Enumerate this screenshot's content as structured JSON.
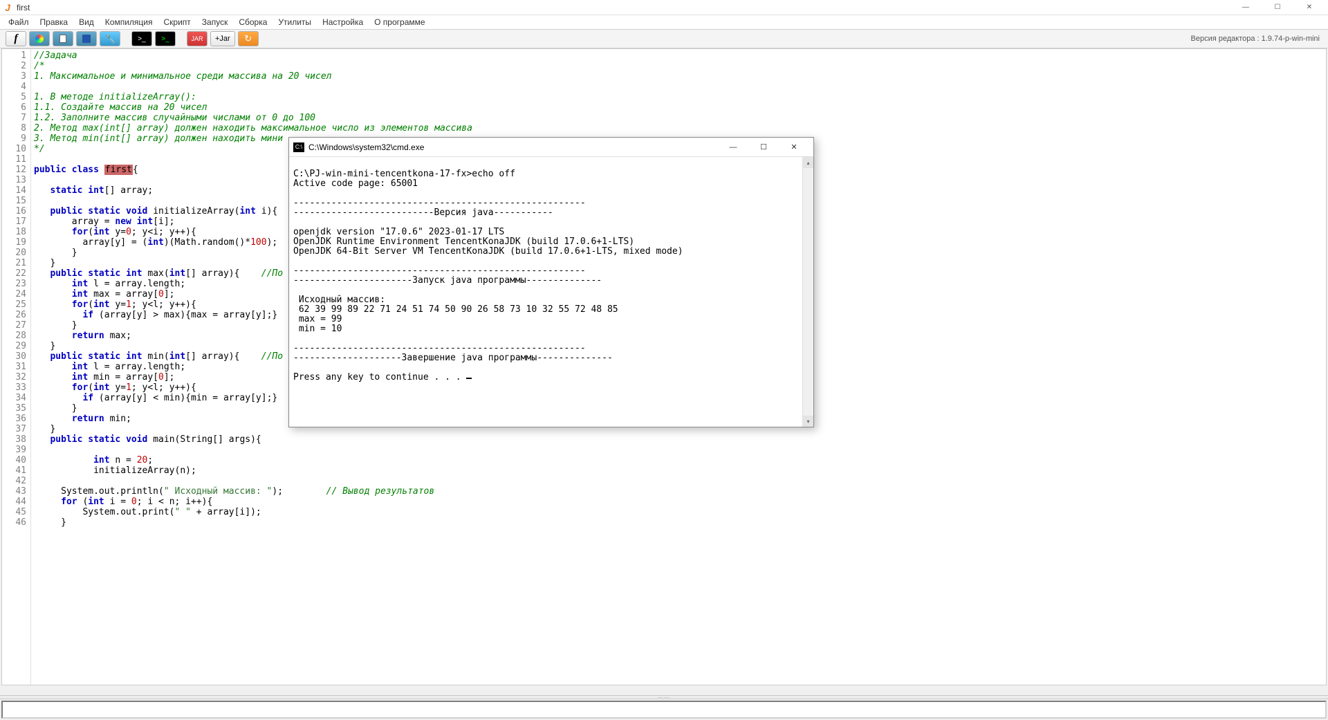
{
  "window": {
    "title": "first"
  },
  "menus": [
    "Файл",
    "Правка",
    "Вид",
    "Компиляция",
    "Скрипт",
    "Запуск",
    "Сборка",
    "Утилиты",
    "Настройка",
    "О программе"
  ],
  "toolbar": {
    "jar_label": "+Jar"
  },
  "version": "Версия редактора : 1.9.74-p-win-mini",
  "code": {
    "lines": [
      {
        "n": 1,
        "html": "<span class='c-comment'>//Задача</span>"
      },
      {
        "n": 2,
        "html": "<span class='c-comment'>/*</span>"
      },
      {
        "n": 3,
        "html": "<span class='c-comment'>1. Максимальное и минимальное среди массива на 20 чисел</span>"
      },
      {
        "n": 4,
        "html": ""
      },
      {
        "n": 5,
        "html": "<span class='c-comment'>1. В методе initializeArray():</span>"
      },
      {
        "n": 6,
        "html": "<span class='c-comment'>1.1. Создайте массив на 20 чисел</span>"
      },
      {
        "n": 7,
        "html": "<span class='c-comment'>1.2. Заполните массив случайными числами от 0 до 100</span>"
      },
      {
        "n": 8,
        "html": "<span class='c-comment'>2. Метод max(int[] array) должен находить максимальное число из элементов массива</span>"
      },
      {
        "n": 9,
        "html": "<span class='c-comment'>3. Метод min(int[] array) должен находить мини</span>"
      },
      {
        "n": 10,
        "html": "<span class='c-comment'>*/</span>"
      },
      {
        "n": 11,
        "html": ""
      },
      {
        "n": 12,
        "html": "<span class='c-keyword'>public</span> <span class='c-keyword'>class</span> <span class='c-classsel'>first</span>{"
      },
      {
        "n": 13,
        "html": ""
      },
      {
        "n": 14,
        "html": "   <span class='c-keyword'>static</span> <span class='c-type'>int</span>[] array;"
      },
      {
        "n": 15,
        "html": ""
      },
      {
        "n": 16,
        "html": "   <span class='c-keyword'>public</span> <span class='c-keyword'>static</span> <span class='c-type'>void</span> initializeArray(<span class='c-type'>int</span> i){"
      },
      {
        "n": 17,
        "html": "       array = <span class='c-keyword'>new</span> <span class='c-type'>int</span>[i];"
      },
      {
        "n": 18,
        "html": "       <span class='c-keyword'>for</span>(<span class='c-type'>int</span> y=<span class='c-num'>0</span>; y&lt;i; y++){"
      },
      {
        "n": 19,
        "html": "         array[y] = (<span class='c-type'>int</span>)(Math.random()*<span class='c-num'>100</span>);"
      },
      {
        "n": 20,
        "html": "       }"
      },
      {
        "n": 21,
        "html": "   }"
      },
      {
        "n": 22,
        "html": "   <span class='c-keyword'>public</span> <span class='c-keyword'>static</span> <span class='c-type'>int</span> max(<span class='c-type'>int</span>[] array){    <span class='c-comment'>//По</span>"
      },
      {
        "n": 23,
        "html": "       <span class='c-type'>int</span> l = array.length;"
      },
      {
        "n": 24,
        "html": "       <span class='c-type'>int</span> max = array[<span class='c-num'>0</span>];"
      },
      {
        "n": 25,
        "html": "       <span class='c-keyword'>for</span>(<span class='c-type'>int</span> y=<span class='c-num'>1</span>; y&lt;l; y++){"
      },
      {
        "n": 26,
        "html": "         <span class='c-keyword'>if</span> (array[y] &gt; max){max = array[y];}"
      },
      {
        "n": 27,
        "html": "       }"
      },
      {
        "n": 28,
        "html": "       <span class='c-keyword'>return</span> max;"
      },
      {
        "n": 29,
        "html": "   }"
      },
      {
        "n": 30,
        "html": "   <span class='c-keyword'>public</span> <span class='c-keyword'>static</span> <span class='c-type'>int</span> min(<span class='c-type'>int</span>[] array){    <span class='c-comment'>//По</span>"
      },
      {
        "n": 31,
        "html": "       <span class='c-type'>int</span> l = array.length;"
      },
      {
        "n": 32,
        "html": "       <span class='c-type'>int</span> min = array[<span class='c-num'>0</span>];"
      },
      {
        "n": 33,
        "html": "       <span class='c-keyword'>for</span>(<span class='c-type'>int</span> y=<span class='c-num'>1</span>; y&lt;l; y++){"
      },
      {
        "n": 34,
        "html": "         <span class='c-keyword'>if</span> (array[y] &lt; min){min = array[y];}"
      },
      {
        "n": 35,
        "html": "       }"
      },
      {
        "n": 36,
        "html": "       <span class='c-keyword'>return</span> min;"
      },
      {
        "n": 37,
        "html": "   }"
      },
      {
        "n": 38,
        "html": "   <span class='c-keyword'>public</span> <span class='c-keyword'>static</span> <span class='c-type'>void</span> main(String[] args){"
      },
      {
        "n": 39,
        "html": ""
      },
      {
        "n": 40,
        "html": "           <span class='c-type'>int</span> n = <span class='c-num'>20</span>;"
      },
      {
        "n": 41,
        "html": "           initializeArray(n);"
      },
      {
        "n": 42,
        "html": ""
      },
      {
        "n": 43,
        "html": "     System.out.println(<span class='c-str'>\" Исходный массив: \"</span>);        <span class='c-comment'>// Вывод результатов</span>"
      },
      {
        "n": 44,
        "html": "     <span class='c-keyword'>for</span> (<span class='c-type'>int</span> i = <span class='c-num'>0</span>; i &lt; n; i++){"
      },
      {
        "n": 45,
        "html": "         System.out.print(<span class='c-str'>\" \"</span> + array[i]);"
      },
      {
        "n": 46,
        "html": "     }"
      }
    ]
  },
  "cmd": {
    "title": "C:\\Windows\\system32\\cmd.exe",
    "lines": [
      "",
      "C:\\PJ-win-mini-tencentkona-17-fx>echo off",
      "Active code page: 65001",
      "",
      "------------------------------------------------------",
      "--------------------------Версия java-----------",
      "",
      "openjdk version \"17.0.6\" 2023-01-17 LTS",
      "OpenJDK Runtime Environment TencentKonaJDK (build 17.0.6+1-LTS)",
      "OpenJDK 64-Bit Server VM TencentKonaJDK (build 17.0.6+1-LTS, mixed mode)",
      "",
      "------------------------------------------------------",
      "----------------------Запуск java программы--------------",
      "",
      " Исходный массив:",
      " 62 39 99 89 22 71 24 51 74 50 90 26 58 73 10 32 55 72 48 85",
      " max = 99",
      " min = 10",
      "",
      "------------------------------------------------------",
      "--------------------Завершение java программы--------------",
      "",
      "Press any key to continue . . . "
    ]
  }
}
